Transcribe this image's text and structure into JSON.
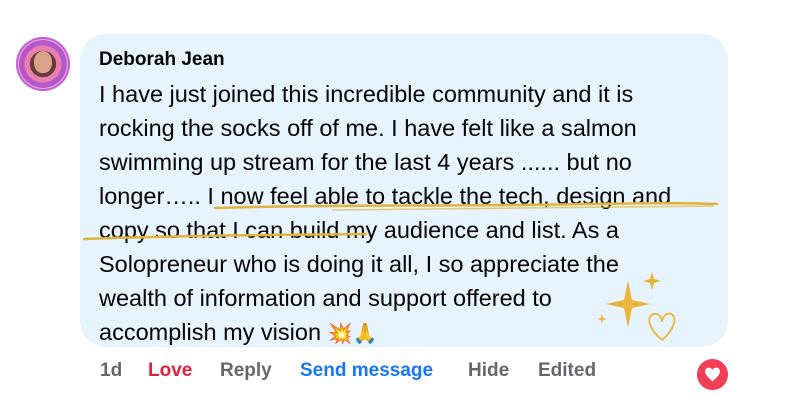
{
  "comment": {
    "author": "Deborah Jean",
    "lines": [
      "I have just joined this incredible community and it is",
      "rocking the socks off of me. I have felt like a salmon",
      "swimming up stream for the last 4 years ...... but no",
      "longer….. I now feel able to tackle the tech, design and",
      "copy so that I can build my audience and list. As a",
      "Solopreneur who is doing it all, I so appreciate the",
      "wealth of information and support offered to",
      "accomplish my vision"
    ],
    "emojis": "💥🙏"
  },
  "actions": {
    "time": "1d",
    "love": "Love",
    "reply": "Reply",
    "send_message": "Send message",
    "hide": "Hide",
    "edited": "Edited"
  },
  "reaction": {
    "icon": "heart-icon",
    "color": "#f33e58"
  },
  "colors": {
    "bubble": "#e7f3fd",
    "love": "#e41e3f",
    "link": "#1877f2",
    "muted": "#65676b",
    "highlight_underline": "#e0b43a"
  }
}
